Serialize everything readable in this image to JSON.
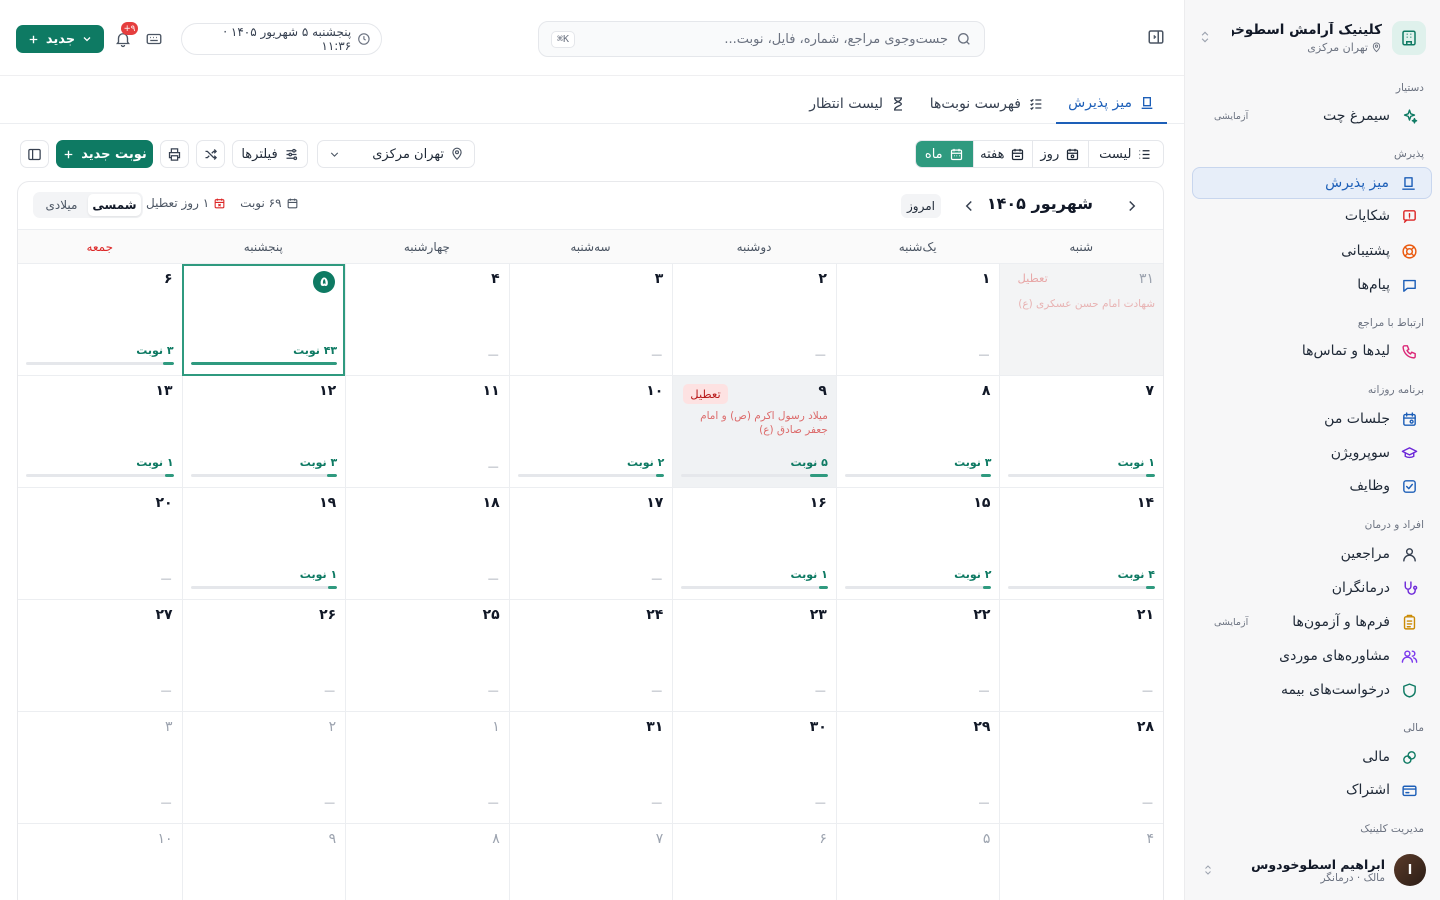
{
  "app": {
    "clinic_name": "کلینیک آرامش اسطوخو...",
    "clinic_branch": "تهران مرکزی"
  },
  "sidebar": {
    "sections": [
      {
        "label": "دستیار"
      },
      {
        "label": "پذیرش"
      },
      {
        "label": "ارتباط با مراجع"
      },
      {
        "label": "برنامه روزانه"
      },
      {
        "label": "افراد و درمان"
      },
      {
        "label": "مالی"
      },
      {
        "label": "مدیریت کلینیک"
      }
    ],
    "items": [
      {
        "label": "سیمرغ چت",
        "icon": "sparkles-icon",
        "badge": "آزمایشی"
      },
      {
        "label": "میز پذیرش",
        "icon": "desk-icon",
        "active": true
      },
      {
        "label": "شکایات",
        "icon": "complaint-icon"
      },
      {
        "label": "پشتیبانی",
        "icon": "lifebuoy-icon"
      },
      {
        "label": "پیام‌ها",
        "icon": "message-icon"
      },
      {
        "label": "لیدها و تماس‌ها",
        "icon": "phone-icon"
      },
      {
        "label": "جلسات من",
        "icon": "calendar-icon"
      },
      {
        "label": "سوپرویژن",
        "icon": "graduation-icon"
      },
      {
        "label": "وظایف",
        "icon": "checkbox-icon"
      },
      {
        "label": "مراجعین",
        "icon": "user-icon"
      },
      {
        "label": "درمانگران",
        "icon": "stethoscope-icon"
      },
      {
        "label": "فرم‌ها و آزمون‌ها",
        "icon": "clipboard-icon",
        "badge": "آزمایشی"
      },
      {
        "label": "مشاوره‌های موردی",
        "icon": "users-icon"
      },
      {
        "label": "درخواست‌های بیمه",
        "icon": "shield-icon"
      },
      {
        "label": "مالی",
        "icon": "coins-icon"
      },
      {
        "label": "اشتراک",
        "icon": "card-icon"
      }
    ],
    "user": {
      "name": "ابراهیم اسطوخودوس",
      "role": "مالک · درمانگر"
    }
  },
  "topbar": {
    "search_placeholder": "جست‌وجوی مراجع، شماره، فایل، نوبت...",
    "search_shortcut": "⌘K",
    "datetime": "پنجشنبه ۵ شهریور ۱۴۰۵ · ۱۱:۳۶",
    "notifications": "۹+",
    "new_button": "جدید"
  },
  "tabs": [
    {
      "label": "میز پذیرش",
      "active": true
    },
    {
      "label": "فهرست نوبت‌ها"
    },
    {
      "label": "لیست انتظار"
    }
  ],
  "toolbar": {
    "views": [
      {
        "label": "لیست"
      },
      {
        "label": "روز"
      },
      {
        "label": "هفته"
      },
      {
        "label": "ماه",
        "active": true
      }
    ],
    "branch": "تهران مرکزی",
    "filters": "فیلترها",
    "new_appointment": "نوبت جدید"
  },
  "calendar": {
    "title": "شهریور ۱۴۰۵",
    "today_label": "امروز",
    "stats": {
      "appointments": "۶۹ نوبت",
      "holidays": "۱ روز تعطیل"
    },
    "calendar_types": [
      {
        "label": "شمسی",
        "active": true
      },
      {
        "label": "میلادی"
      }
    ],
    "weekdays": [
      "شنبه",
      "یک‌شنبه",
      "دوشنبه",
      "سه‌شنبه",
      "چهارشنبه",
      "پنجشنبه",
      "جمعه"
    ],
    "weeks": [
      [
        {
          "day": "۳۱",
          "faded": true,
          "prev": true,
          "holiday": "تعطیل",
          "holiday_name": "شهادت امام حسن عسکری (ع)"
        },
        {
          "day": "۱",
          "empty": "—"
        },
        {
          "day": "۲",
          "empty": "—"
        },
        {
          "day": "۳",
          "empty": "—"
        },
        {
          "day": "۴",
          "empty": "—"
        },
        {
          "day": "۵",
          "today": true,
          "count": "۴۳ نوبت",
          "fill": 1.0
        },
        {
          "day": "۶",
          "count": "۳ نوبت",
          "fill": 0.07
        }
      ],
      [
        {
          "day": "۷",
          "count": "۱ نوبت",
          "fill": 0.05
        },
        {
          "day": "۸",
          "count": "۳ نوبت",
          "fill": 0.07
        },
        {
          "day": "۹",
          "holiday": "تعطیل",
          "holiday_name": "میلاد رسول اکرم (ص) و امام جعفر صادق (ع)",
          "count": "۵ نوبت",
          "fill": 0.12
        },
        {
          "day": "۱۰",
          "count": "۲ نوبت",
          "fill": 0.06
        },
        {
          "day": "۱۱",
          "empty": "—"
        },
        {
          "day": "۱۲",
          "count": "۳ نوبت",
          "fill": 0.07
        },
        {
          "day": "۱۳",
          "count": "۱ نوبت",
          "fill": 0.05
        }
      ],
      [
        {
          "day": "۱۴",
          "count": "۴ نوبت",
          "fill": 0.06
        },
        {
          "day": "۱۵",
          "count": "۲ نوبت",
          "fill": 0.06
        },
        {
          "day": "۱۶",
          "count": "۱ نوبت",
          "fill": 0.05
        },
        {
          "day": "۱۷",
          "empty": "—"
        },
        {
          "day": "۱۸",
          "empty": "—"
        },
        {
          "day": "۱۹",
          "count": "۱ نوبت",
          "fill": 0.05
        },
        {
          "day": "۲۰",
          "empty": "—"
        }
      ],
      [
        {
          "day": "۲۱",
          "empty": "—"
        },
        {
          "day": "۲۲",
          "empty": "—"
        },
        {
          "day": "۲۳",
          "empty": "—"
        },
        {
          "day": "۲۴",
          "empty": "—"
        },
        {
          "day": "۲۵",
          "empty": "—"
        },
        {
          "day": "۲۶",
          "empty": "—"
        },
        {
          "day": "۲۷",
          "empty": "—"
        }
      ],
      [
        {
          "day": "۲۸",
          "empty": "—"
        },
        {
          "day": "۲۹",
          "empty": "—"
        },
        {
          "day": "۳۰",
          "empty": "—"
        },
        {
          "day": "۳۱",
          "empty": "—"
        },
        {
          "day": "۱",
          "faded": true,
          "empty": "—"
        },
        {
          "day": "۲",
          "faded": true,
          "empty": "—"
        },
        {
          "day": "۳",
          "faded": true,
          "empty": "—"
        }
      ],
      [
        {
          "day": "۴",
          "faded": true
        },
        {
          "day": "۵",
          "faded": true
        },
        {
          "day": "۶",
          "faded": true
        },
        {
          "day": "۷",
          "faded": true
        },
        {
          "day": "۸",
          "faded": true
        },
        {
          "day": "۹",
          "faded": true
        },
        {
          "day": "۱۰",
          "faded": true
        }
      ]
    ]
  },
  "colors": {
    "primary": "#0e7a63",
    "accent": "#1d5fb8",
    "holiday": "#dc2626"
  }
}
